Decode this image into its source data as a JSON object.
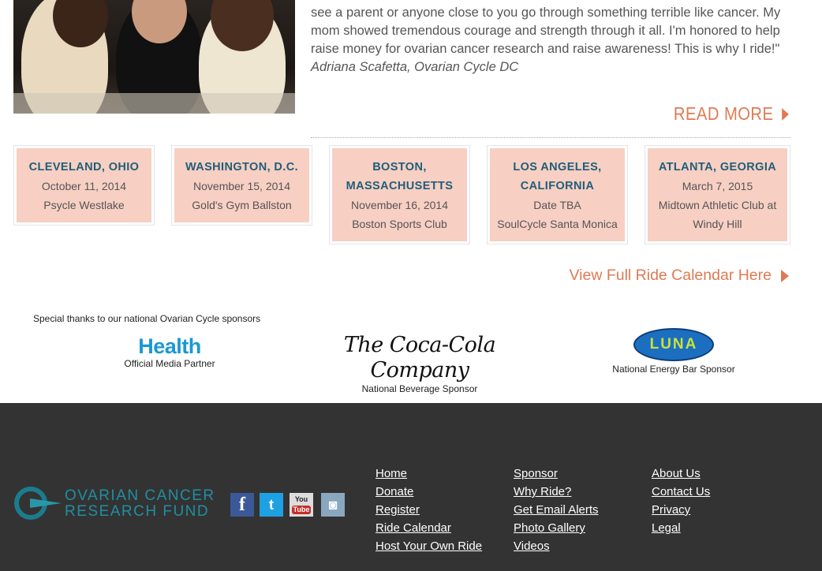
{
  "testimonial": {
    "quote": "see a parent or anyone close to you go through something terrible like cancer. My mom showed tremendous courage and strength through it all. I'm honored to help raise money for ovarian cancer research and raise awareness! This is why I ride!\"",
    "author": "Adriana Scafetta, Ovarian Cycle DC",
    "read_more": "READ MORE"
  },
  "rides": [
    {
      "city": "CLEVELAND, OHIO",
      "date": "October 11, 2014",
      "venue": "Psycle Westlake"
    },
    {
      "city": "WASHINGTON, D.C.",
      "date": "November 15, 2014",
      "venue": "Gold's Gym Ballston"
    },
    {
      "city": "BOSTON, MASSACHUSETTS",
      "date": "November 16, 2014",
      "venue": "Boston Sports Club"
    },
    {
      "city": "LOS ANGELES, CALIFORNIA",
      "date": "Date TBA",
      "venue": "SoulCycle Santa Monica"
    },
    {
      "city": "ATLANTA, GEORGIA",
      "date": "March 7, 2015",
      "venue": "Midtown Athletic Club at Windy Hill"
    }
  ],
  "calendar_link": "View Full Ride Calendar Here",
  "sponsors": {
    "intro": "Special thanks to our national Ovarian Cycle sponsors",
    "health": {
      "logo": "Health",
      "caption": "Official Media Partner"
    },
    "coke": {
      "logo": "The Coca-Cola Company",
      "caption": "National Beverage Sponsor"
    },
    "luna": {
      "logo": "LUNA",
      "caption": "National Energy Bar Sponsor"
    }
  },
  "footer": {
    "logo_line1": "OVARIAN CANCER",
    "logo_line2": "RESEARCH FUND",
    "social": {
      "facebook": "f",
      "twitter": "t",
      "youtube_top": "You",
      "youtube_bottom": "Tube",
      "instagram": "◙"
    },
    "col1": [
      "Home",
      "Donate",
      "Register",
      "Ride Calendar",
      "Host Your Own Ride"
    ],
    "col2": [
      "Sponsor",
      "Why Ride?",
      "Get Email Alerts",
      "Photo Gallery",
      "Videos"
    ],
    "col3": [
      "About Us",
      "Contact Us",
      "Privacy",
      "Legal"
    ]
  },
  "colors": {
    "accent": "#e07a52",
    "ride_bg": "#f7cfc3",
    "city": "#1f5e78",
    "footer_bg": "#333333",
    "ocrf_teal": "#1f8fa2"
  }
}
